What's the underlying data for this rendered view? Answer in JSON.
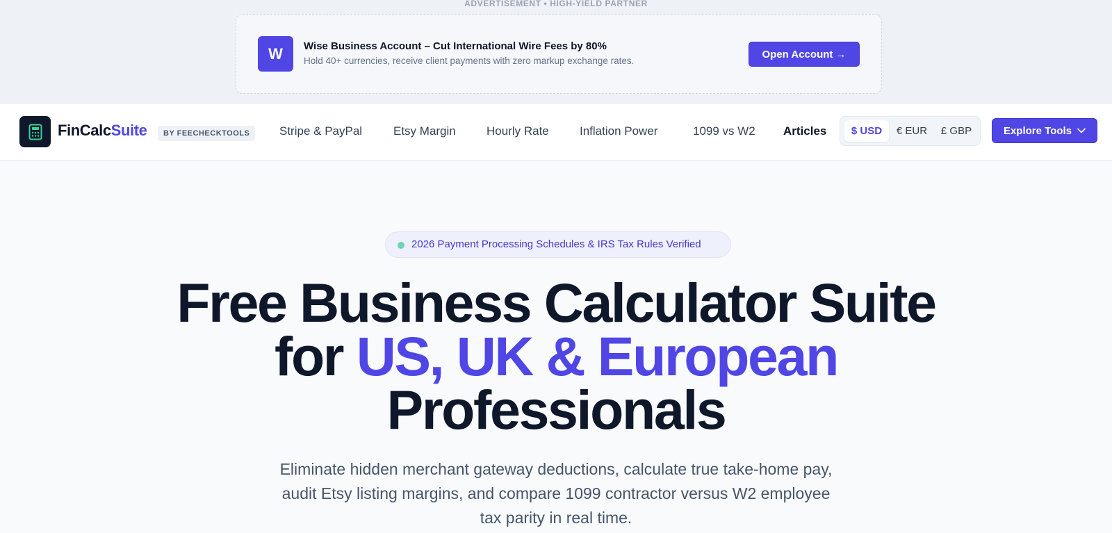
{
  "ad": {
    "kicker": "ADVERTISEMENT • HIGH-YIELD PARTNER",
    "logo_letter": "W",
    "title": "Wise Business Account – Cut International Wire Fees by 80%",
    "subtitle": "Hold 40+ currencies, receive client payments with zero markup exchange rates.",
    "cta_label": "Open Account →"
  },
  "header": {
    "brand_primary": "FinCalc",
    "brand_accent": "Suite",
    "brand_by": "BY FEECHECKTOOLS",
    "brand_icon": "calculator-icon",
    "nav": [
      {
        "label": "Stripe & PayPal"
      },
      {
        "label": "Etsy Margin"
      },
      {
        "label": "Hourly Rate"
      },
      {
        "label": "Inflation Power"
      },
      {
        "label": "1099 vs W2"
      },
      {
        "label": "Articles"
      }
    ],
    "currencies": [
      {
        "label": "$ USD",
        "active": true
      },
      {
        "label": "€ EUR",
        "active": false
      },
      {
        "label": "£ GBP",
        "active": false
      }
    ],
    "explore_label": "Explore Tools",
    "explore_icon": "chevron-down-icon"
  },
  "hero": {
    "badge": "2026 Payment Processing Schedules & IRS Tax Rules Verified",
    "title_line1": "Free Business Calculator Suite",
    "title_for": "for ",
    "title_highlight": "US, UK & European",
    "title_line3": "Professionals",
    "subtitle_line1": "Eliminate hidden merchant gateway deductions, calculate true take-home pay,",
    "subtitle_line2": "audit Etsy listing margins, and compare 1099 contractor versus W2 employee",
    "subtitle_line3": "tax parity in real time."
  },
  "colors": {
    "accent": "#4f46e5",
    "text": "#0f172a",
    "muted": "#475569",
    "status_dot": "#6fd3b6"
  }
}
